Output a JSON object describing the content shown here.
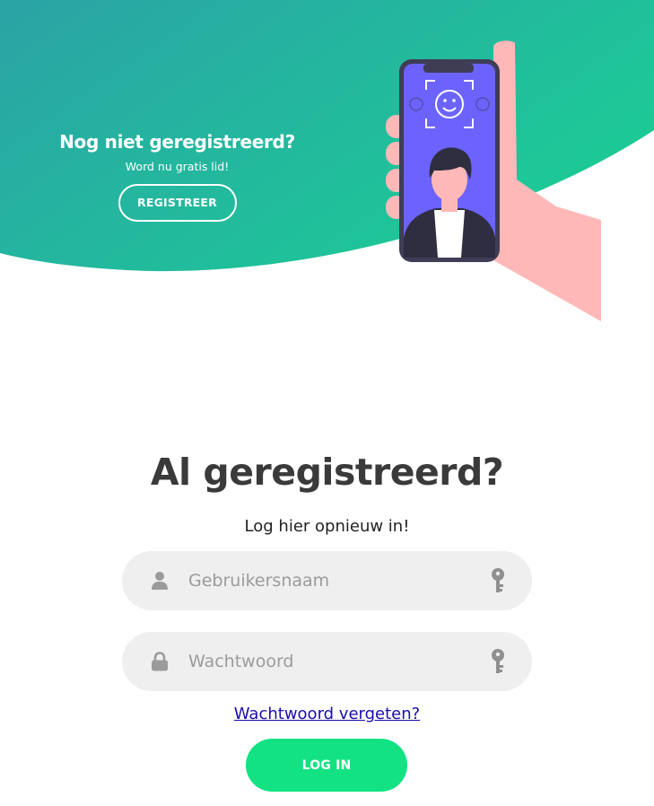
{
  "colors": {
    "gradient_start": "#2ba3a6",
    "gradient_end": "#1ccb96",
    "accent_green": "#13e282",
    "phone_screen": "#6c63ff",
    "hand": "#ffb8b8",
    "title_text": "#3a3a3a",
    "field_bg": "#efefef",
    "link": "#1a0dab"
  },
  "promo": {
    "title": "Nog niet geregistreerd?",
    "subtitle": "Word nu gratis lid!",
    "register_label": "REGISTREER"
  },
  "illustration": {
    "name": "phone-face-recognition-illustration"
  },
  "login": {
    "title": "Al geregistreerd?",
    "subtitle": "Log hier opnieuw in!",
    "username_placeholder": "Gebruikersnaam",
    "username_value": "",
    "password_placeholder": "Wachtwoord",
    "password_value": "",
    "forgot_label": "Wachtwoord vergeten?",
    "login_label": "LOG IN"
  },
  "icons": {
    "username_icon": "user-icon",
    "password_icon": "lock-icon",
    "key_icon": "key-icon"
  }
}
